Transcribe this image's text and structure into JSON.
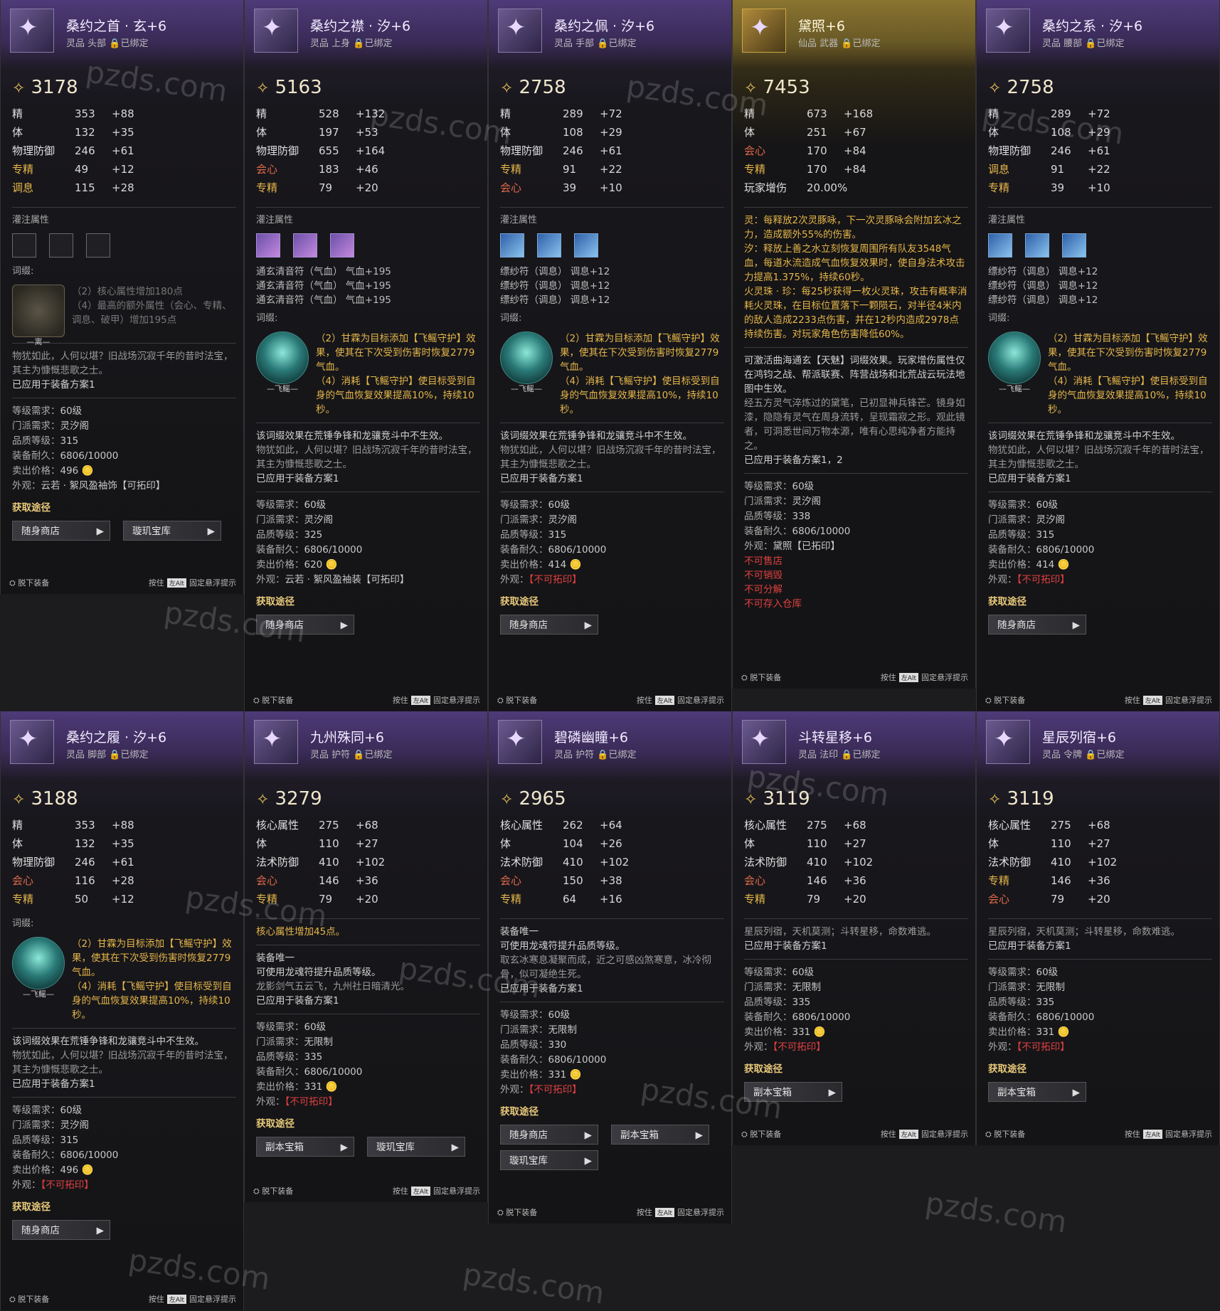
{
  "watermark": "pzds.com",
  "footer": {
    "unequip": "脱下装备",
    "press": "按住",
    "key": "左Alt",
    "pin": "固定悬浮提示"
  },
  "labels": {
    "infusion": "灌注属性",
    "ciji": "词缀:",
    "acquire": "获取途径"
  },
  "cards": [
    {
      "title": "桑约之首 · 玄+6",
      "subtitle": "灵品  头部  🔒已绑定",
      "score": "3178",
      "stats": [
        {
          "n": "精",
          "v": "353",
          "b": "+88",
          "c": ""
        },
        {
          "n": "体",
          "v": "132",
          "b": "+35",
          "c": ""
        },
        {
          "n": "物理防御",
          "v": "246",
          "b": "+61",
          "c": ""
        },
        {
          "n": "专精",
          "v": "49",
          "b": "+12",
          "c": "gold"
        },
        {
          "n": "调息",
          "v": "115",
          "b": "+28",
          "c": "gold"
        }
      ],
      "slots": "empty",
      "runes": [],
      "ciji_badge": "gray",
      "ciji_caption": "—离—",
      "effects": [
        "（2）核心属性增加180点",
        "（4）最高的额外属性（会心、专精、调息、破甲）增加195点"
      ],
      "effect_dim": true,
      "notice": "",
      "lore": "物犹如此，人何以堪？旧战场沉寂千年的昔时法宝，其主为慷慨悲歌之士。",
      "applied": "已应用于装备方案1",
      "info": [
        [
          "等级需求",
          "60级"
        ],
        [
          "门派需求",
          "灵汐阁"
        ],
        [
          "品质等级",
          "315"
        ],
        [
          "装备耐久",
          "6806/10000"
        ],
        [
          "卖出价格",
          "496 🪙"
        ],
        [
          "外观",
          "云若 · 絮风盈袖饰【可拓印】"
        ]
      ],
      "extra": [],
      "buttons": [
        "随身商店",
        "璇玑宝库"
      ]
    },
    {
      "title": "桑约之襟 · 汐+6",
      "subtitle": "灵品  上身  🔒已绑定",
      "score": "5163",
      "stats": [
        {
          "n": "精",
          "v": "528",
          "b": "+132",
          "c": ""
        },
        {
          "n": "体",
          "v": "197",
          "b": "+53",
          "c": ""
        },
        {
          "n": "物理防御",
          "v": "655",
          "b": "+164",
          "c": ""
        },
        {
          "n": "会心",
          "v": "183",
          "b": "+46",
          "c": "red"
        },
        {
          "n": "专精",
          "v": "79",
          "b": "+20",
          "c": "gold"
        }
      ],
      "slots": "filled",
      "runes": [
        "通玄清音符（气血） 气血+195",
        "通玄清音符（气血） 气血+195",
        "通玄清音符（气血） 气血+195"
      ],
      "ciji_badge": "teal",
      "ciji_caption": "—飞鳐—",
      "effects": [
        "（2）甘霖为目标添加【飞鳐守护】效果，使其在下次受到伤害时恢复2779气血。",
        "（4）消耗【飞鳐守护】使目标受到自身的气血恢复效果提高10%，持续10秒。"
      ],
      "effect_dim": false,
      "notice": "该词缀效果在荒锤争锋和龙骧竞斗中不生效。",
      "lore": "物犹如此，人何以堪？旧战场沉寂千年的昔时法宝，其主为慷慨悲歌之士。",
      "applied": "已应用于装备方案1",
      "info": [
        [
          "等级需求",
          "60级"
        ],
        [
          "门派需求",
          "灵汐阁"
        ],
        [
          "品质等级",
          "325"
        ],
        [
          "装备耐久",
          "6806/10000"
        ],
        [
          "卖出价格",
          "620 🪙"
        ],
        [
          "外观",
          "云若 · 絮风盈袖装【可拓印】"
        ]
      ],
      "extra": [],
      "buttons": [
        "随身商店"
      ]
    },
    {
      "title": "桑约之佩 · 汐+6",
      "subtitle": "灵品  手部  🔒已绑定",
      "score": "2758",
      "stats": [
        {
          "n": "精",
          "v": "289",
          "b": "+72",
          "c": ""
        },
        {
          "n": "体",
          "v": "108",
          "b": "+29",
          "c": ""
        },
        {
          "n": "物理防御",
          "v": "246",
          "b": "+61",
          "c": ""
        },
        {
          "n": "专精",
          "v": "91",
          "b": "+22",
          "c": "gold"
        },
        {
          "n": "会心",
          "v": "39",
          "b": "+10",
          "c": "red"
        }
      ],
      "slots": "blue",
      "runes": [
        "缥纱符（调息） 调息+12",
        "缥纱符（调息） 调息+12",
        "缥纱符（调息） 调息+12"
      ],
      "ciji_badge": "teal",
      "ciji_caption": "—飞鳐—",
      "effects": [
        "（2）甘霖为目标添加【飞鳐守护】效果，使其在下次受到伤害时恢复2779气血。",
        "（4）消耗【飞鳐守护】使目标受到自身的气血恢复效果提高10%，持续10秒。"
      ],
      "effect_dim": false,
      "notice": "该词缀效果在荒锤争锋和龙骧竞斗中不生效。",
      "lore": "物犹如此，人何以堪？旧战场沉寂千年的昔时法宝，其主为慷慨悲歌之士。",
      "applied": "已应用于装备方案1",
      "info": [
        [
          "等级需求",
          "60级"
        ],
        [
          "门派需求",
          "灵汐阁"
        ],
        [
          "品质等级",
          "315"
        ],
        [
          "装备耐久",
          "6806/10000"
        ],
        [
          "卖出价格",
          "414 🪙"
        ],
        [
          "外观",
          "【不可拓印】"
        ]
      ],
      "extra": [],
      "buttons": [
        "随身商店"
      ]
    },
    {
      "title": "黛照+6",
      "subtitle": "仙品  武器  🔒已绑定",
      "score": "7453",
      "gold": true,
      "stats": [
        {
          "n": "精",
          "v": "673",
          "b": "+168",
          "c": ""
        },
        {
          "n": "体",
          "v": "251",
          "b": "+67",
          "c": ""
        },
        {
          "n": "会心",
          "v": "170",
          "b": "+84",
          "c": "red"
        },
        {
          "n": "专精",
          "v": "170",
          "b": "+84",
          "c": "gold"
        },
        {
          "n": "玩家增伤",
          "v": "20.00%",
          "b": "",
          "c": ""
        }
      ],
      "slots": "none",
      "runes": [],
      "ciji_badge": "none",
      "ciji_caption": "",
      "effects": [
        "灵：每释放2次灵豚咏，下一次灵豚咏会附加玄冰之力，造成额外55%的伤害。",
        "汐：释放上善之水立刻恢复周围所有队友3548气血，每道水流造成气血恢复效果时，使自身法术攻击力提高1.375%，持续60秒。",
        "火灵珠 · 珍：每25秒获得一枚火灵珠，攻击有概率消耗火灵珠，在目标位置落下一颗陨石，对半径4米内的敌人造成2233点伤害，并在12秒内造成2978点持续伤害。对玩家角色伤害降低60%。"
      ],
      "effect_dim": false,
      "notice": "可激活曲海通玄【天魅】词缀效果。玩家增伤属性仅在鸿钧之战、帮派联赛、阵营战场和北荒战云玩法地图中生效。",
      "lore": "经五方灵气淬炼过的黛笔，已初显神兵锋芒。镜身如漆，隐隐有灵气在周身流转，呈现霜寂之形。观此镜者，可洞悉世间万物本源，唯有心思纯净者方能持之。",
      "applied": "已应用于装备方案1，2",
      "info": [
        [
          "等级需求",
          "60级"
        ],
        [
          "门派需求",
          "灵汐阁"
        ],
        [
          "品质等级",
          "338"
        ],
        [
          "装备耐久",
          "6806/10000"
        ],
        [
          "外观",
          "黛照【已拓印】"
        ]
      ],
      "extra": [
        "不可售店",
        "不可销毁",
        "不可分解",
        "不可存入仓库"
      ],
      "buttons": []
    },
    {
      "title": "桑约之系 · 汐+6",
      "subtitle": "灵品  腰部  🔒已绑定",
      "score": "2758",
      "stats": [
        {
          "n": "精",
          "v": "289",
          "b": "+72",
          "c": ""
        },
        {
          "n": "体",
          "v": "108",
          "b": "+29",
          "c": ""
        },
        {
          "n": "物理防御",
          "v": "246",
          "b": "+61",
          "c": ""
        },
        {
          "n": "调息",
          "v": "91",
          "b": "+22",
          "c": "gold"
        },
        {
          "n": "专精",
          "v": "39",
          "b": "+10",
          "c": "gold"
        }
      ],
      "slots": "blue",
      "runes": [
        "缥纱符（调息） 调息+12",
        "缥纱符（调息） 调息+12",
        "缥纱符（调息） 调息+12"
      ],
      "ciji_badge": "teal",
      "ciji_caption": "—飞鳐—",
      "effects": [
        "（2）甘霖为目标添加【飞鳐守护】效果，使其在下次受到伤害时恢复2779气血。",
        "（4）消耗【飞鳐守护】使目标受到自身的气血恢复效果提高10%，持续10秒。"
      ],
      "effect_dim": false,
      "notice": "该词缀效果在荒锤争锋和龙骧竞斗中不生效。",
      "lore": "物犹如此，人何以堪？旧战场沉寂千年的昔时法宝，其主为慷慨悲歌之士。",
      "applied": "已应用于装备方案1",
      "info": [
        [
          "等级需求",
          "60级"
        ],
        [
          "门派需求",
          "灵汐阁"
        ],
        [
          "品质等级",
          "315"
        ],
        [
          "装备耐久",
          "6806/10000"
        ],
        [
          "卖出价格",
          "414 🪙"
        ],
        [
          "外观",
          "【不可拓印】"
        ]
      ],
      "extra": [],
      "buttons": [
        "随身商店"
      ]
    },
    {
      "title": "桑约之履 · 汐+6",
      "subtitle": "灵品  脚部  🔒已绑定",
      "score": "3188",
      "stats": [
        {
          "n": "精",
          "v": "353",
          "b": "+88",
          "c": ""
        },
        {
          "n": "体",
          "v": "132",
          "b": "+35",
          "c": ""
        },
        {
          "n": "物理防御",
          "v": "246",
          "b": "+61",
          "c": ""
        },
        {
          "n": "会心",
          "v": "116",
          "b": "+28",
          "c": "red"
        },
        {
          "n": "专精",
          "v": "50",
          "b": "+12",
          "c": "gold"
        }
      ],
      "slots": "none",
      "runes": [],
      "ciji_badge": "teal",
      "ciji_caption": "—飞鳐—",
      "effects": [
        "（2）甘霖为目标添加【飞鳐守护】效果，使其在下次受到伤害时恢复2779气血。",
        "（4）消耗【飞鳐守护】使目标受到自身的气血恢复效果提高10%，持续10秒。"
      ],
      "effect_dim": false,
      "notice": "该词缀效果在荒锤争锋和龙骧竞斗中不生效。",
      "lore": "物犹如此，人何以堪？旧战场沉寂千年的昔时法宝，其主为慷慨悲歌之士。",
      "applied": "已应用于装备方案1",
      "info": [
        [
          "等级需求",
          "60级"
        ],
        [
          "门派需求",
          "灵汐阁"
        ],
        [
          "品质等级",
          "315"
        ],
        [
          "装备耐久",
          "6806/10000"
        ],
        [
          "卖出价格",
          "496 🪙"
        ],
        [
          "外观",
          "【不可拓印】"
        ]
      ],
      "extra": [],
      "buttons": [
        "随身商店"
      ]
    },
    {
      "title": "九州殊同+6",
      "subtitle": "灵品  护符  🔒已绑定",
      "score": "3279",
      "stats": [
        {
          "n": "核心属性",
          "v": "275",
          "b": "+68",
          "c": ""
        },
        {
          "n": "体",
          "v": "110",
          "b": "+27",
          "c": ""
        },
        {
          "n": "法术防御",
          "v": "410",
          "b": "+102",
          "c": ""
        },
        {
          "n": "会心",
          "v": "146",
          "b": "+36",
          "c": "red"
        },
        {
          "n": "专精",
          "v": "79",
          "b": "+20",
          "c": "gold"
        }
      ],
      "slots": "none",
      "runes": [],
      "ciji_badge": "none",
      "ciji_caption": "",
      "effects": [
        "核心属性增加45点。"
      ],
      "effect_dim": false,
      "notice": "装备唯一\n可使用龙魂符提升品质等级。",
      "lore": "龙影剑气五云飞，九州社日暗清光。",
      "applied": "已应用于装备方案1",
      "info": [
        [
          "等级需求",
          "60级"
        ],
        [
          "门派需求",
          "无限制"
        ],
        [
          "品质等级",
          "335"
        ],
        [
          "装备耐久",
          "6806/10000"
        ],
        [
          "卖出价格",
          "331 🪙"
        ],
        [
          "外观",
          "【不可拓印】"
        ]
      ],
      "extra": [],
      "buttons": [
        "副本宝箱",
        "璇玑宝库"
      ]
    },
    {
      "title": "碧磷幽瞳+6",
      "subtitle": "灵品  护符  🔒已绑定",
      "score": "2965",
      "stats": [
        {
          "n": "核心属性",
          "v": "262",
          "b": "+64",
          "c": ""
        },
        {
          "n": "体",
          "v": "104",
          "b": "+26",
          "c": ""
        },
        {
          "n": "法术防御",
          "v": "410",
          "b": "+102",
          "c": ""
        },
        {
          "n": "会心",
          "v": "150",
          "b": "+38",
          "c": "red"
        },
        {
          "n": "专精",
          "v": "64",
          "b": "+16",
          "c": "gold"
        }
      ],
      "slots": "none",
      "runes": [],
      "ciji_badge": "none",
      "ciji_caption": "",
      "effects": [],
      "effect_dim": false,
      "notice": "装备唯一\n可使用龙魂符提升品质等级。",
      "lore": "取玄冰寒息凝聚而成，近之可感凶煞寒意，冰冷彻骨，似可凝绝生死。",
      "applied": "已应用于装备方案1",
      "info": [
        [
          "等级需求",
          "60级"
        ],
        [
          "门派需求",
          "无限制"
        ],
        [
          "品质等级",
          "330"
        ],
        [
          "装备耐久",
          "6806/10000"
        ],
        [
          "卖出价格",
          "331 🪙"
        ],
        [
          "外观",
          "【不可拓印】"
        ]
      ],
      "extra": [],
      "buttons": [
        "随身商店",
        "副本宝箱",
        "璇玑宝库"
      ]
    },
    {
      "title": "斗转星移+6",
      "subtitle": "灵品  法印  🔒已绑定",
      "score": "3119",
      "stats": [
        {
          "n": "核心属性",
          "v": "275",
          "b": "+68",
          "c": ""
        },
        {
          "n": "体",
          "v": "110",
          "b": "+27",
          "c": ""
        },
        {
          "n": "法术防御",
          "v": "410",
          "b": "+102",
          "c": ""
        },
        {
          "n": "会心",
          "v": "146",
          "b": "+36",
          "c": "red"
        },
        {
          "n": "专精",
          "v": "79",
          "b": "+20",
          "c": "gold"
        }
      ],
      "slots": "none",
      "runes": [],
      "ciji_badge": "none",
      "ciji_caption": "",
      "effects": [],
      "effect_dim": false,
      "notice": "",
      "lore": "星辰列宿，天机莫测；斗转星移，命数难逃。",
      "applied": "已应用于装备方案1",
      "info": [
        [
          "等级需求",
          "60级"
        ],
        [
          "门派需求",
          "无限制"
        ],
        [
          "品质等级",
          "335"
        ],
        [
          "装备耐久",
          "6806/10000"
        ],
        [
          "卖出价格",
          "331 🪙"
        ],
        [
          "外观",
          "【不可拓印】"
        ]
      ],
      "extra": [],
      "buttons": [
        "副本宝箱"
      ]
    },
    {
      "title": "星辰列宿+6",
      "subtitle": "灵品  令牌  🔒已绑定",
      "score": "3119",
      "stats": [
        {
          "n": "核心属性",
          "v": "275",
          "b": "+68",
          "c": ""
        },
        {
          "n": "体",
          "v": "110",
          "b": "+27",
          "c": ""
        },
        {
          "n": "法术防御",
          "v": "410",
          "b": "+102",
          "c": ""
        },
        {
          "n": "专精",
          "v": "146",
          "b": "+36",
          "c": "gold"
        },
        {
          "n": "会心",
          "v": "79",
          "b": "+20",
          "c": "red"
        }
      ],
      "slots": "none",
      "runes": [],
      "ciji_badge": "none",
      "ciji_caption": "",
      "effects": [],
      "effect_dim": false,
      "notice": "",
      "lore": "星辰列宿，天机莫测；斗转星移，命数难逃。",
      "applied": "已应用于装备方案1",
      "info": [
        [
          "等级需求",
          "60级"
        ],
        [
          "门派需求",
          "无限制"
        ],
        [
          "品质等级",
          "335"
        ],
        [
          "装备耐久",
          "6806/10000"
        ],
        [
          "卖出价格",
          "331 🪙"
        ],
        [
          "外观",
          "【不可拓印】"
        ]
      ],
      "extra": [],
      "buttons": [
        "副本宝箱"
      ]
    }
  ]
}
